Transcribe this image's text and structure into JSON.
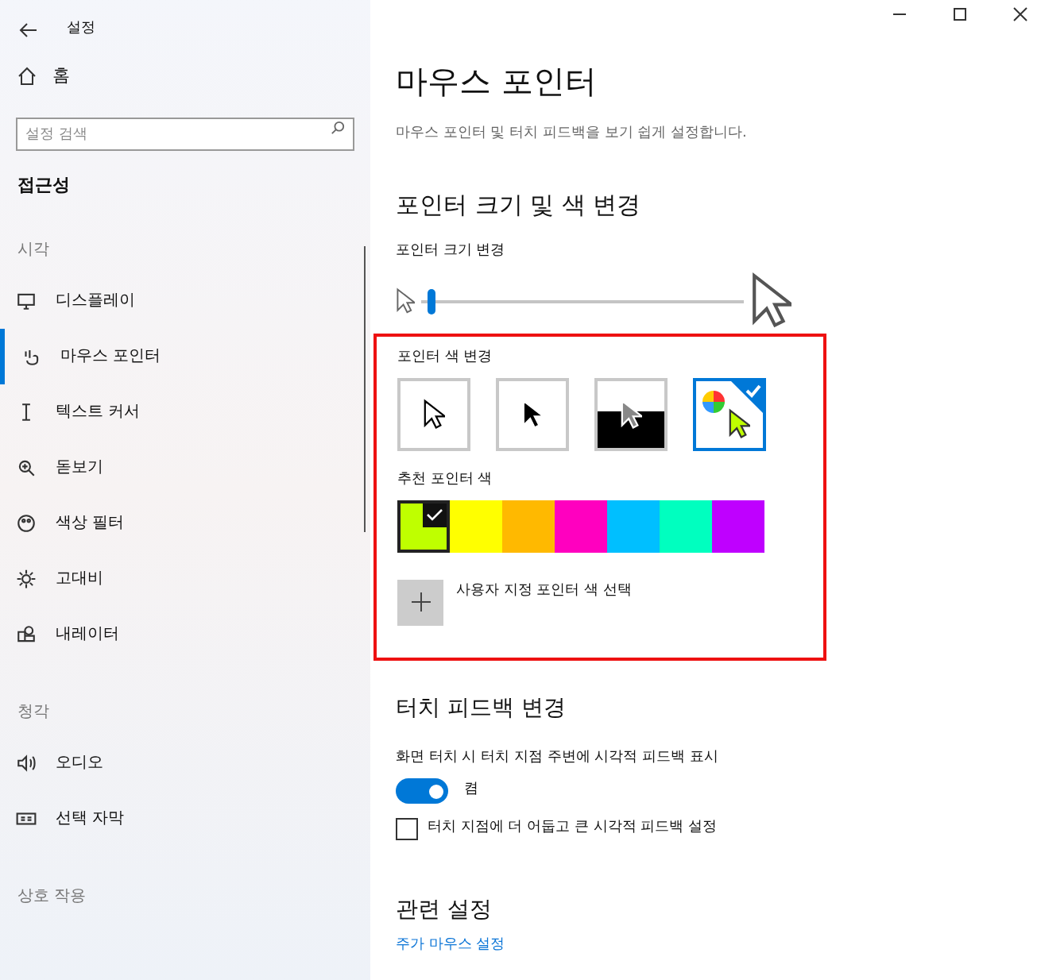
{
  "window": {
    "title": "설정"
  },
  "sidebar": {
    "home": "홈",
    "search": {
      "placeholder": "설정 검색"
    },
    "heading": "접근성",
    "groups": [
      {
        "title": "시각",
        "items": [
          {
            "label": "디스플레이",
            "selected": false
          },
          {
            "label": "마우스 포인터",
            "selected": true
          },
          {
            "label": "텍스트 커서",
            "selected": false
          },
          {
            "label": "돋보기",
            "selected": false
          },
          {
            "label": "색상 필터",
            "selected": false
          },
          {
            "label": "고대비",
            "selected": false
          },
          {
            "label": "내레이터",
            "selected": false
          }
        ]
      },
      {
        "title": "청각",
        "items": [
          {
            "label": "오디오",
            "selected": false
          },
          {
            "label": "선택 자막",
            "selected": false
          }
        ]
      },
      {
        "title": "상호 작용"
      }
    ]
  },
  "main": {
    "title": "마우스 포인터",
    "subtitle": "마우스 포인터 및 터치 피드백을 보기 쉽게 설정합니다.",
    "pointer_section": {
      "title": "포인터 크기 및 색 변경",
      "size_label": "포인터 크기 변경",
      "size_slider": {
        "level": 0.02
      },
      "color_label": "포인터 색 변경",
      "styles": [
        {
          "kind": "white",
          "selected": false
        },
        {
          "kind": "black",
          "selected": false
        },
        {
          "kind": "inverted",
          "selected": false
        },
        {
          "kind": "custom",
          "selected": true
        }
      ],
      "suggested_label": "추천 포인터 색",
      "swatches": [
        {
          "color": "#bfff00",
          "selected": true
        },
        {
          "color": "#ffff00",
          "selected": false
        },
        {
          "color": "#ffb900",
          "selected": false
        },
        {
          "color": "#ff00bf",
          "selected": false
        },
        {
          "color": "#00bfff",
          "selected": false
        },
        {
          "color": "#00ffbf",
          "selected": false
        },
        {
          "color": "#bf00ff",
          "selected": false
        }
      ],
      "custom_label": "사용자 지정 포인터 색 선택"
    },
    "touch_section": {
      "title": "터치 피드백 변경",
      "toggle_label": "화면 터치 시 터치 지점 주변에 시각적 피드백 표시",
      "toggle": {
        "on": true,
        "state_text": "켬"
      },
      "checkbox": {
        "label": "터치 지점에 더 어둡고 큰 시각적 피드백 설정",
        "checked": false
      }
    },
    "related": {
      "title": "관련 설정",
      "link": "주가 마우스 설정"
    }
  }
}
